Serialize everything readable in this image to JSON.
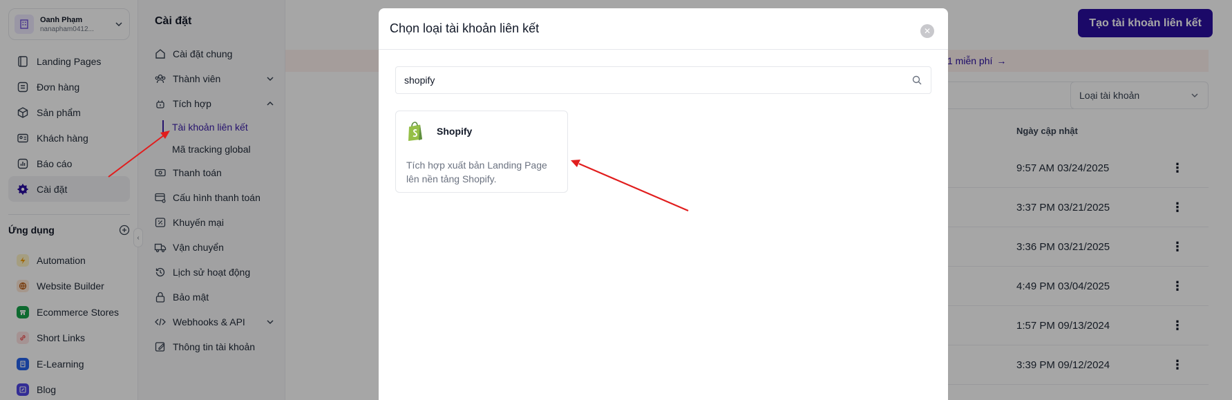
{
  "account": {
    "name": "Oanh Phạm",
    "email": "nanapham0412..."
  },
  "sidebar": {
    "items": [
      {
        "label": "Landing Pages",
        "icon": "layers-icon"
      },
      {
        "label": "Đơn hàng",
        "icon": "orders-icon"
      },
      {
        "label": "Sản phẩm",
        "icon": "box-icon"
      },
      {
        "label": "Khách hàng",
        "icon": "contact-card-icon"
      },
      {
        "label": "Báo cáo",
        "icon": "chart-icon"
      },
      {
        "label": "Cài đặt",
        "icon": "gear-icon",
        "active": true
      }
    ],
    "apps_title": "Ứng dụng",
    "apps": [
      {
        "label": "Automation",
        "color": "#f59e0b"
      },
      {
        "label": "Website Builder",
        "color": "#b45309"
      },
      {
        "label": "Ecommerce Stores",
        "color": "#16a34a"
      },
      {
        "label": "Short Links",
        "color": "#ef4444"
      },
      {
        "label": "E-Learning",
        "color": "#2563eb"
      },
      {
        "label": "Blog",
        "color": "#4f46e5"
      }
    ]
  },
  "settings": {
    "title": "Cài đặt",
    "items": [
      {
        "label": "Cài đặt chung"
      },
      {
        "label": "Thành viên"
      },
      {
        "label": "Tích hợp"
      },
      {
        "label": "Tài khoản liên kết"
      },
      {
        "label": "Mã tracking global"
      },
      {
        "label": "Thanh toán"
      },
      {
        "label": "Cấu hình thanh toán"
      },
      {
        "label": "Khuyến mại"
      },
      {
        "label": "Vận chuyển"
      },
      {
        "label": "Lịch sử hoạt động"
      },
      {
        "label": "Bảo mật"
      },
      {
        "label": "Webhooks & API"
      },
      {
        "label": "Thông tin tài khoản"
      }
    ]
  },
  "main": {
    "create_button": "Tạo tài khoản liên kết",
    "promo_text": "1 miễn phí",
    "type_select": "Loại tài khoản",
    "column_header": "Ngày cập nhật",
    "rows": [
      {
        "date": "9:57 AM 03/24/2025"
      },
      {
        "date": "3:37 PM 03/21/2025"
      },
      {
        "date": "3:36 PM 03/21/2025"
      },
      {
        "date": "4:49 PM 03/04/2025"
      },
      {
        "date": "1:57 PM 09/13/2024"
      },
      {
        "date": "3:39 PM 09/12/2024"
      }
    ]
  },
  "modal": {
    "title": "Chọn loại tài khoản liên kết",
    "search_value": "shopify",
    "result": {
      "name": "Shopify",
      "description": "Tích hợp xuất bản Landing Page lên nền tảng Shopify."
    }
  },
  "colors": {
    "accent": "#2a0fa0",
    "annotation": "#e11d1d",
    "shopify_green": "#95bf47"
  }
}
